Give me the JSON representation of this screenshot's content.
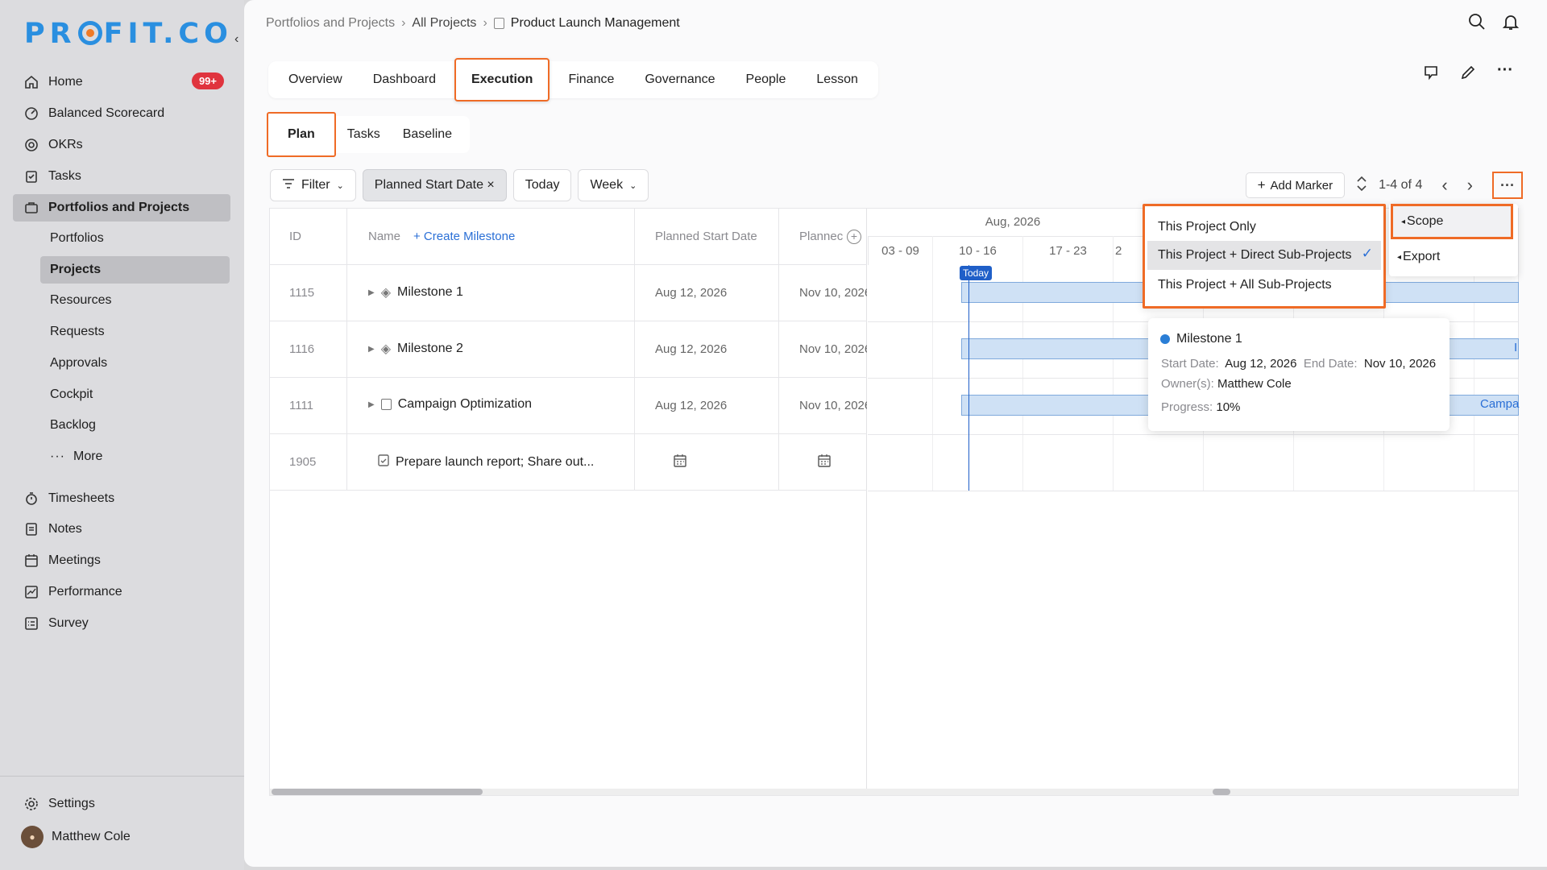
{
  "sidebar": {
    "logo": "PR FIT.CO",
    "nav": [
      {
        "label": "Home",
        "badge": "99+"
      },
      {
        "label": "Balanced Scorecard"
      },
      {
        "label": "OKRs"
      },
      {
        "label": "Tasks"
      },
      {
        "label": "Portfolios and Projects"
      }
    ],
    "sub": [
      "Portfolios",
      "Projects",
      "Resources",
      "Requests",
      "Approvals",
      "Cockpit",
      "Backlog",
      "More"
    ],
    "nav2": [
      "Timesheets",
      "Notes",
      "Meetings",
      "Performance",
      "Survey"
    ],
    "settings": "Settings",
    "user": "Matthew Cole"
  },
  "breadcrumb": [
    "Portfolios and Projects",
    "All Projects",
    "Product Launch Management"
  ],
  "tabs": [
    "Overview",
    "Dashboard",
    "Execution",
    "Finance",
    "Governance",
    "People",
    "Lesson"
  ],
  "subtabs": [
    "Plan",
    "Tasks",
    "Baseline"
  ],
  "toolbar": {
    "filter": "Filter",
    "sort_chip": "Planned Start Date ×",
    "today": "Today",
    "week": "Week",
    "add_marker": "Add Marker",
    "pager": "1-4 of 4"
  },
  "grid": {
    "headers": {
      "id": "ID",
      "name": "Name",
      "create": "+ Create Milestone",
      "pstart": "Planned Start Date",
      "pend": "Plannec"
    },
    "rows": [
      {
        "id": "1115",
        "name": "Milestone 1",
        "start": "Aug 12, 2026",
        "end": "Nov 10, 2026"
      },
      {
        "id": "1116",
        "name": "Milestone 2",
        "start": "Aug 12, 2026",
        "end": "Nov 10, 2026"
      },
      {
        "id": "1111",
        "name": "Campaign Optimization",
        "start": "Aug 12, 2026",
        "end": "Nov 10, 2026"
      },
      {
        "id": "1905",
        "name": "Prepare launch report; Share out...",
        "start": "",
        "end": ""
      }
    ]
  },
  "gantt": {
    "month": "Aug, 2026",
    "weeks": [
      "03 - 09",
      "10 - 16",
      "17 - 23",
      "2"
    ],
    "today": "Today",
    "bar_label": "Campa"
  },
  "scope_menu": {
    "options": [
      "This Project Only",
      "This Project + Direct Sub-Projects",
      "This Project + All Sub-Projects"
    ]
  },
  "more_menu": {
    "options": [
      "Scope",
      "Export"
    ]
  },
  "tooltip": {
    "title": "Milestone 1",
    "start_label": "Start Date:",
    "start": "Aug 12, 2026",
    "end_label": "End Date:",
    "end": "Nov 10, 2026",
    "owner_label": "Owner(s):",
    "owner": "Matthew Cole",
    "progress_label": "Progress:",
    "progress": "10%"
  },
  "colors": {
    "accent": "#ef6b26",
    "brand": "#2a8fe0",
    "link": "#2a6fd6"
  }
}
